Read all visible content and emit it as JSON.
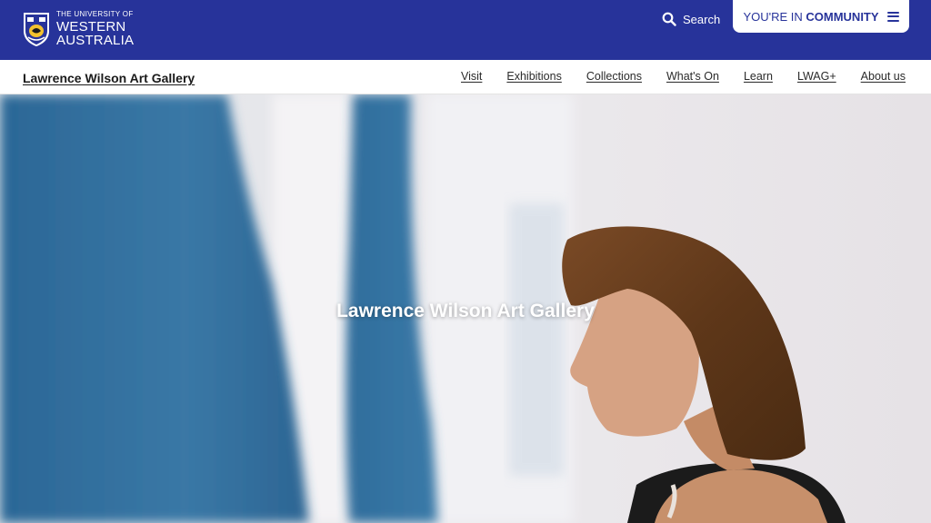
{
  "header": {
    "logo": {
      "line1": "THE UNIVERSITY OF",
      "line2": "WESTERN",
      "line3": "AUSTRALIA"
    },
    "search_label": "Search",
    "community": {
      "prefix": "YOU'RE IN",
      "name": "COMMUNITY"
    }
  },
  "subnav": {
    "site_title": "Lawrence Wilson Art Gallery",
    "links": [
      "Visit",
      "Exhibitions",
      "Collections",
      "What's On",
      "Learn",
      "LWAG+",
      "About us"
    ]
  },
  "hero": {
    "title": "Lawrence Wilson Art Gallery"
  },
  "colors": {
    "brand_blue": "#27339a",
    "white": "#ffffff",
    "artwork_blue": "#2f6b9a"
  }
}
